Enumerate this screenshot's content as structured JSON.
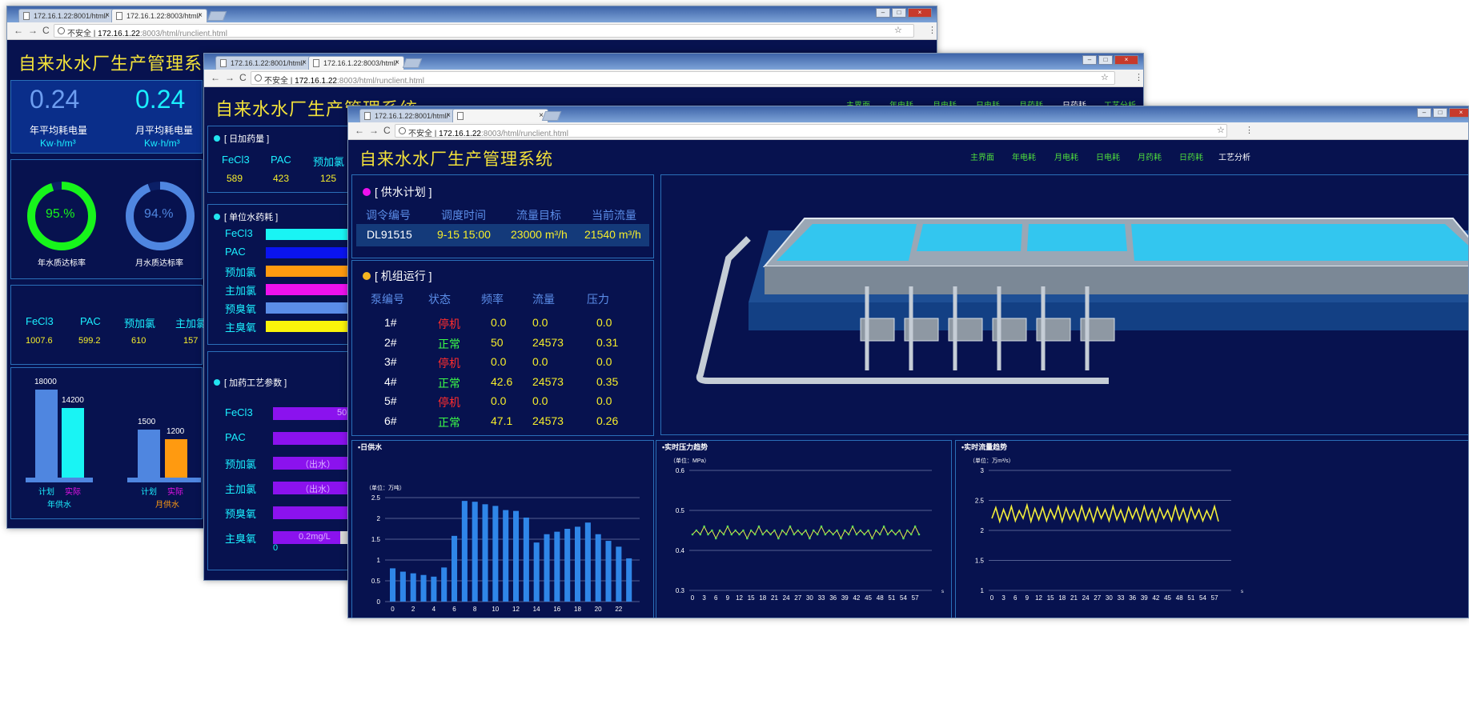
{
  "browser": {
    "tabs": [
      "172.16.1.22:8001/html/",
      "172.16.1.22:8003/html/"
    ],
    "tab3_label": "172.16.1.22:8003/html/",
    "insecure": "不安全",
    "url_host": "172.16.1.22",
    "url_path": ":8003/html/runclient.html",
    "win_min": "–",
    "win_max": "□",
    "win_close": "×",
    "nav_back": "←",
    "nav_fwd": "→",
    "nav_reload": "C",
    "star": "☆",
    "menu": "⋮"
  },
  "app": {
    "title": "自来水水厂生产管理系统",
    "nav": [
      "主界面",
      "年电耗",
      "月电耗",
      "日电耗",
      "月药耗",
      "日药耗",
      "工艺分析"
    ],
    "nav_selected_window2": "日药耗",
    "nav_selected_window3": "工艺分析"
  },
  "win1": {
    "kpi": [
      {
        "value": "0.24",
        "label": "年平均耗电量",
        "unit": "Kw·h/m³"
      },
      {
        "value": "0.24",
        "label": "月平均耗电量",
        "unit": "Kw·h/m³"
      }
    ],
    "gauges": [
      {
        "value": "95.%",
        "label": "年水质达标率",
        "fraction": 0.95,
        "color": "#17f51b"
      },
      {
        "value": "94.%",
        "label": "月水质达标率",
        "fraction": 0.94,
        "color": "#4f86e0"
      }
    ],
    "chem_names": [
      "FeCl3",
      "PAC",
      "预加氯",
      "主加氯"
    ],
    "chem_values": [
      "1007.6",
      "599.2",
      "610",
      "157"
    ],
    "year_supply": {
      "plan": 18000,
      "actual": 14200,
      "plan_label": "计划",
      "actual_label": "实际",
      "title": "年供水"
    },
    "month_supply": {
      "plan": 1500,
      "actual": 1200,
      "plan_label": "计划",
      "actual_label": "实际",
      "title": "月供水"
    }
  },
  "win2": {
    "daily_dose_title": "[ 日加药量 ]",
    "daily_dose_names": [
      "FeCl3",
      "PAC",
      "预加氯"
    ],
    "daily_dose_values": [
      "589",
      "423",
      "125"
    ],
    "unit_cons_title": "[ 单位水药耗 ]",
    "unit_cons": [
      {
        "name": "FeCl3",
        "color": "#19f4f4"
      },
      {
        "name": "PAC",
        "color": "#0a14f0"
      },
      {
        "name": "预加氯",
        "color": "#ff9a10"
      },
      {
        "name": "主加氯",
        "color": "#ee11ee"
      },
      {
        "name": "预臭氧",
        "color": "#5b8de8"
      },
      {
        "name": "主臭氧",
        "color": "#fbf40a"
      }
    ],
    "process_title": "[ 加药工艺参数 ]",
    "process": [
      {
        "name": "FeCl3",
        "text": "50"
      },
      {
        "name": "PAC",
        "text": ""
      },
      {
        "name": "预加氯",
        "text": "（出水）"
      },
      {
        "name": "主加氯",
        "text": "（出水）"
      },
      {
        "name": "预臭氧",
        "text": ""
      },
      {
        "name": "主臭氧",
        "text": "0.2mg/L"
      }
    ],
    "axis_zero": "0"
  },
  "win3": {
    "supply_plan": {
      "title": "[ 供水计划 ]",
      "headers": [
        "调令编号",
        "调度时间",
        "流量目标",
        "当前流量"
      ],
      "row": [
        "DL91515",
        "9-15 15:00",
        "23000 m³/h",
        "21540 m³/h"
      ]
    },
    "units": {
      "title": "[ 机组运行 ]",
      "headers": [
        "泵编号",
        "状态",
        "频率",
        "流量",
        "压力"
      ],
      "rows": [
        [
          "1#",
          "停机",
          "0.0",
          "0.0",
          "0.0"
        ],
        [
          "2#",
          "正常",
          "50",
          "24573",
          "0.31"
        ],
        [
          "3#",
          "停机",
          "0.0",
          "0.0",
          "0.0"
        ],
        [
          "4#",
          "正常",
          "42.6",
          "24573",
          "0.35"
        ],
        [
          "5#",
          "停机",
          "0.0",
          "0.0",
          "0.0"
        ],
        [
          "6#",
          "正常",
          "47.1",
          "24573",
          "0.26"
        ]
      ]
    },
    "status_colors": {
      "停机": "#ff2c2c",
      "正常": "#3cff48"
    }
  },
  "chart_data": [
    {
      "type": "bar",
      "title": "•日供水",
      "ylabel": "（单位：万吨）",
      "ylim": [
        0,
        2.5
      ],
      "yticks": [
        "0",
        "0.5",
        "1",
        "1.5",
        "2",
        "2.5"
      ],
      "xtick_labels": [
        "0",
        "2",
        "4",
        "6",
        "8",
        "10",
        "12",
        "14",
        "16",
        "18",
        "20",
        "22"
      ],
      "categories": [
        0,
        1,
        2,
        3,
        4,
        5,
        6,
        7,
        8,
        9,
        10,
        11,
        12,
        13,
        14,
        15,
        16,
        17,
        18,
        19,
        20,
        21,
        22,
        23
      ],
      "values": [
        0.8,
        0.72,
        0.68,
        0.64,
        0.6,
        0.82,
        1.58,
        2.42,
        2.4,
        2.34,
        2.3,
        2.2,
        2.18,
        2.02,
        1.42,
        1.62,
        1.68,
        1.75,
        1.8,
        1.9,
        1.62,
        1.46,
        1.32,
        1.04
      ],
      "color": "#2f86e8",
      "grid": true
    },
    {
      "type": "line",
      "title": "•实时压力趋势",
      "ylabel": "（单位：MPa）",
      "ylim": [
        0.3,
        0.6
      ],
      "yticks": [
        "0.3",
        "0.4",
        "0.5",
        "0.6"
      ],
      "xtick_labels": [
        "0",
        "3",
        "6",
        "9",
        "12",
        "15",
        "18",
        "21",
        "24",
        "27",
        "30",
        "33",
        "36",
        "39",
        "42",
        "45",
        "48",
        "51",
        "54",
        "57"
      ],
      "xlabel": "s",
      "x": [
        0,
        1,
        2,
        3,
        4,
        5,
        6,
        7,
        8,
        9,
        10,
        11,
        12,
        13,
        14,
        15,
        16,
        17,
        18,
        19,
        20,
        21,
        22,
        23,
        24,
        25,
        26,
        27,
        28,
        29,
        30,
        31,
        32,
        33,
        34,
        35,
        36,
        37,
        38,
        39,
        40,
        41,
        42,
        43,
        44,
        45,
        46,
        47,
        48,
        49,
        50,
        51,
        52,
        53,
        54,
        55,
        56,
        57,
        58
      ],
      "values": [
        0.44,
        0.45,
        0.44,
        0.46,
        0.44,
        0.45,
        0.43,
        0.45,
        0.44,
        0.46,
        0.44,
        0.45,
        0.44,
        0.45,
        0.43,
        0.45,
        0.44,
        0.46,
        0.44,
        0.45,
        0.44,
        0.45,
        0.43,
        0.45,
        0.44,
        0.46,
        0.44,
        0.45,
        0.44,
        0.45,
        0.43,
        0.45,
        0.44,
        0.46,
        0.44,
        0.45,
        0.44,
        0.45,
        0.43,
        0.45,
        0.44,
        0.46,
        0.44,
        0.45,
        0.44,
        0.45,
        0.43,
        0.45,
        0.44,
        0.46,
        0.44,
        0.45,
        0.44,
        0.45,
        0.43,
        0.45,
        0.44,
        0.46,
        0.44
      ],
      "color": "#e7f04a",
      "markers": true,
      "grid": true
    },
    {
      "type": "line",
      "title": "•实时流量趋势",
      "ylabel": "（单位：万m³/s）",
      "ylim": [
        1,
        3
      ],
      "yticks": [
        "1",
        "1.5",
        "2",
        "2.5",
        "3"
      ],
      "xtick_labels": [
        "0",
        "3",
        "6",
        "9",
        "12",
        "15",
        "18",
        "21",
        "24",
        "27",
        "30",
        "33",
        "36",
        "39",
        "42",
        "45",
        "48",
        "51",
        "54",
        "57"
      ],
      "xlabel": "s",
      "x": [
        0,
        1,
        2,
        3,
        4,
        5,
        6,
        7,
        8,
        9,
        10,
        11,
        12,
        13,
        14,
        15,
        16,
        17,
        18,
        19,
        20,
        21,
        22,
        23,
        24,
        25,
        26,
        27,
        28,
        29,
        30,
        31,
        32,
        33,
        34,
        35,
        36,
        37,
        38,
        39,
        40,
        41,
        42,
        43,
        44,
        45,
        46,
        47,
        48,
        49,
        50,
        51,
        52,
        53,
        54,
        55,
        56,
        57,
        58
      ],
      "values": [
        2.2,
        2.38,
        2.15,
        2.35,
        2.18,
        2.4,
        2.16,
        2.33,
        2.2,
        2.42,
        2.15,
        2.36,
        2.18,
        2.38,
        2.16,
        2.35,
        2.2,
        2.4,
        2.15,
        2.37,
        2.19,
        2.34,
        2.16,
        2.4,
        2.18,
        2.36,
        2.15,
        2.38,
        2.2,
        2.35,
        2.16,
        2.4,
        2.18,
        2.34,
        2.15,
        2.38,
        2.2,
        2.36,
        2.16,
        2.4,
        2.18,
        2.35,
        2.15,
        2.37,
        2.2,
        2.34,
        2.16,
        2.4,
        2.18,
        2.36,
        2.15,
        2.38,
        2.2,
        2.35,
        2.16,
        2.33,
        2.19,
        2.4,
        2.15
      ],
      "color": "#f3ee3a",
      "markers": false,
      "grid": true
    }
  ]
}
